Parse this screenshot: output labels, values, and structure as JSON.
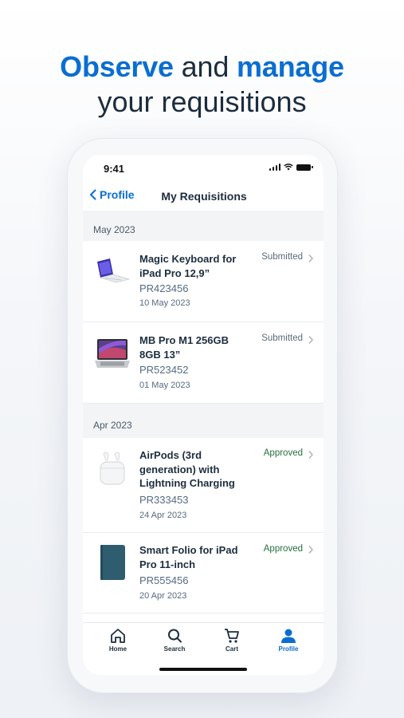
{
  "headline": {
    "word1": "Observe",
    "word2": " and ",
    "word3": "manage",
    "line2": "your requisitions"
  },
  "status_bar": {
    "time": "9:41"
  },
  "nav": {
    "back_label": "Profile",
    "title": "My Requisitions"
  },
  "sections": [
    {
      "header": "May 2023",
      "items": [
        {
          "name": "Magic Keyboard for iPad Pro 12,9”",
          "id": "PR423456",
          "date": "10 May 2023",
          "status": "Submitted"
        },
        {
          "name": "MB Pro M1 256GB 8GB 13”",
          "id": "PR523452",
          "date": "01 May 2023",
          "status": "Submitted"
        }
      ]
    },
    {
      "header": "Apr 2023",
      "items": [
        {
          "name": "AirPods (3rd generation) with Lightning Charging",
          "id": "PR333453",
          "date": "24 Apr 2023",
          "status": "Approved"
        },
        {
          "name": "Smart Folio for iPad Pro 11-inch",
          "id": "PR555456",
          "date": "20 Apr 2023",
          "status": "Approved"
        }
      ]
    }
  ],
  "tabbar": {
    "home": "Home",
    "search": "Search",
    "cart": "Cart",
    "profile": "Profile",
    "active": "Profile"
  },
  "colors": {
    "accent": "#0a6ed1",
    "approved": "#256f3a",
    "submitted": "#5b6b7a",
    "text": "#1d2d3e"
  }
}
